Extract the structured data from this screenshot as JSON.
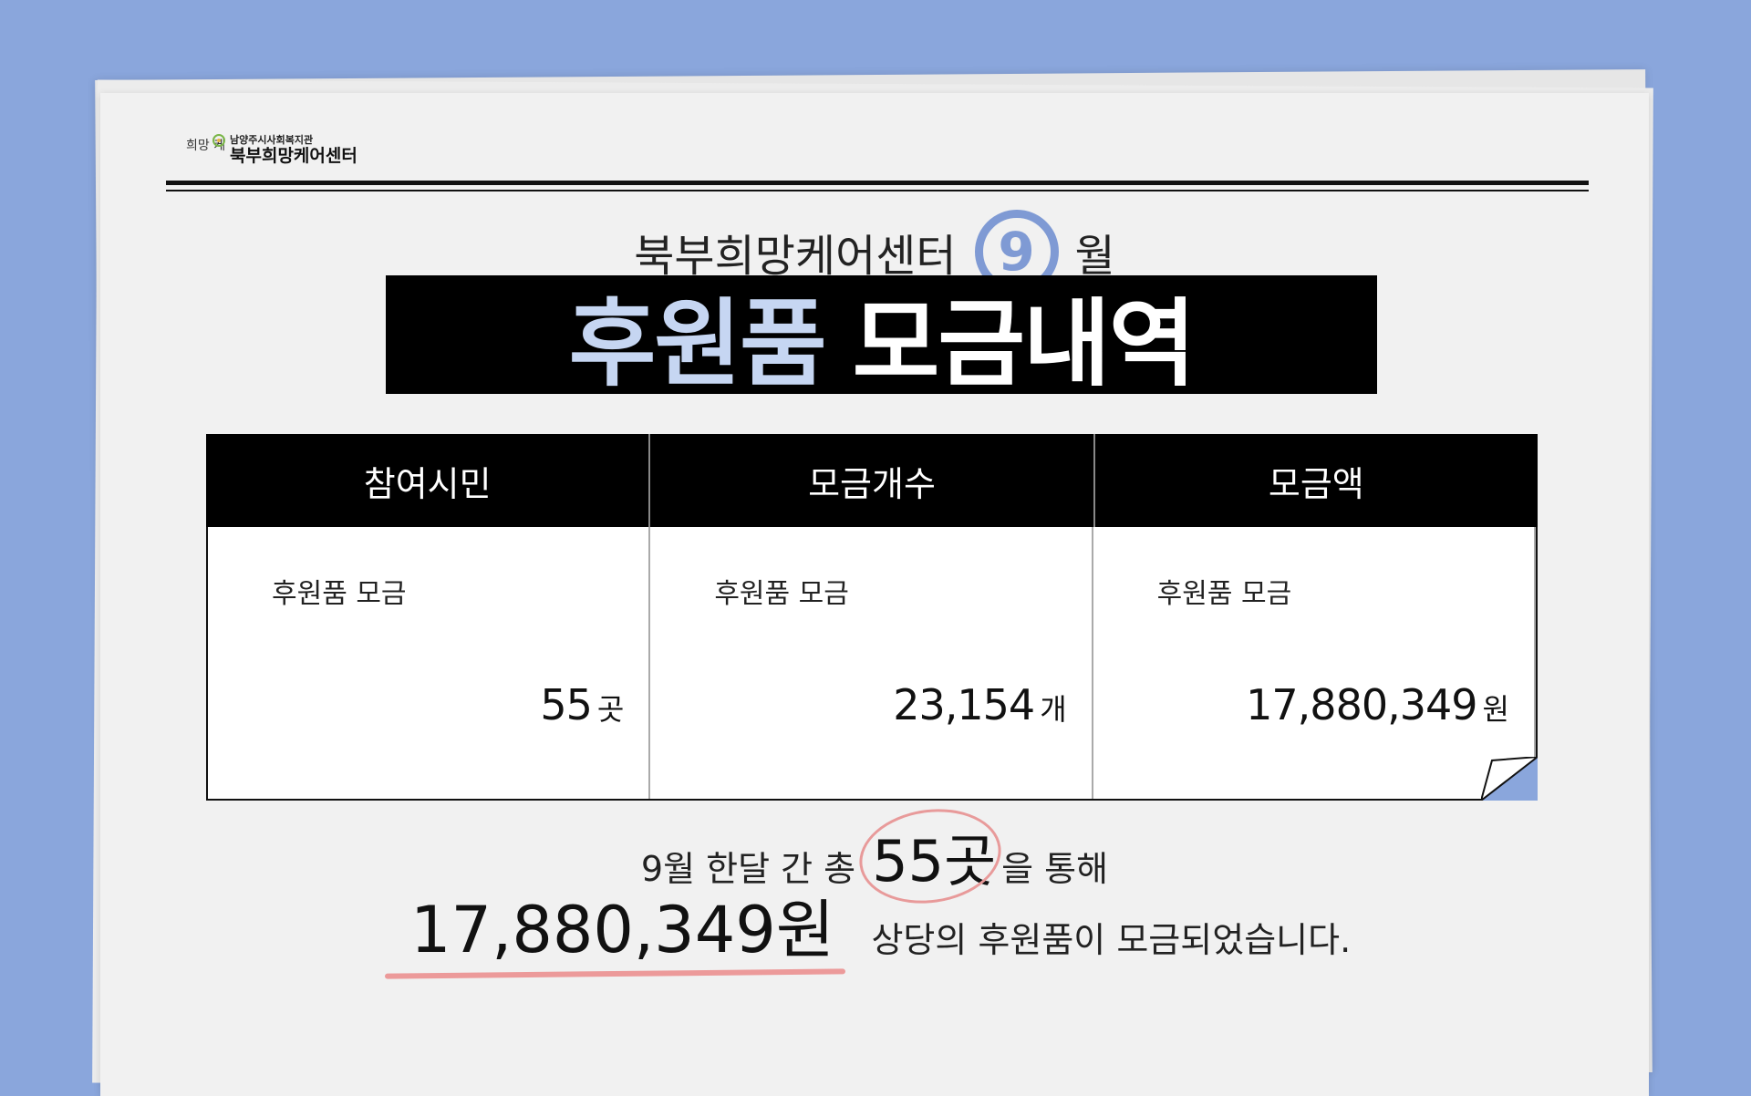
{
  "logo": {
    "mark_text": "희망 케어",
    "sub": "남양주시사회복지관",
    "main": "북부희망케어센터"
  },
  "subtitle": {
    "before": "북부희망케어센터",
    "month": "9",
    "after": "월"
  },
  "title": {
    "part1": "후원품",
    "part2": "모금내역"
  },
  "table": {
    "headers": [
      "참여시민",
      "모금개수",
      "모금액"
    ],
    "cells": [
      {
        "label": "후원품 모금",
        "value": "55",
        "unit": "곳"
      },
      {
        "label": "후원품 모금",
        "value": "23,154",
        "unit": "개"
      },
      {
        "label": "후원품 모금",
        "value": "17,880,349",
        "unit": "원"
      }
    ]
  },
  "summary": {
    "line1_before": "9월 한달 간 총",
    "line1_count": "55곳",
    "line1_after": "을 통해",
    "line2_amount": "17,880,349원",
    "line2_after": "상당의 후원품이 모금되었습니다."
  },
  "colors": {
    "background": "#8aa6dc",
    "accent_blue": "#7f9ad4",
    "title_light_blue": "#c6d6f2",
    "highlight_pink": "#ec9a9a"
  }
}
